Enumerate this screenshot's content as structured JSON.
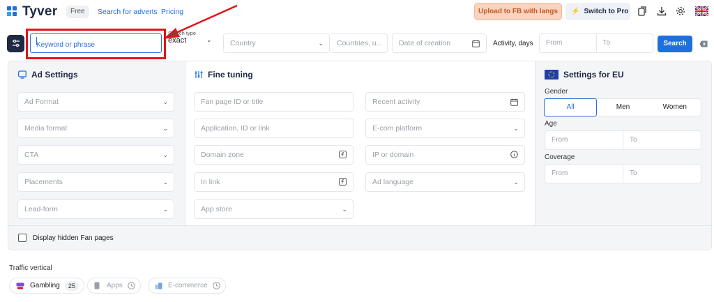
{
  "header": {
    "logo_text": "Tyver",
    "plan_badge": "Free",
    "nav": [
      "Search for adverts",
      "Pricing"
    ],
    "upload_button": "Upload to FB with langs",
    "pro_button": "Switch to Pro",
    "language": "EN (UK flag)"
  },
  "search": {
    "keyword_placeholder": "Keyword or phrase",
    "search_type_label": "Search type",
    "search_type_value": "exact",
    "country_placeholder": "Country",
    "countries_placeholder": "Countries, u...",
    "date_placeholder": "Date of creation",
    "activity_label": "Activity, days",
    "from_placeholder": "From",
    "to_placeholder": "To",
    "search_button": "Search"
  },
  "ad_settings": {
    "title": "Ad Settings",
    "fields": [
      "Ad Format",
      "Media format",
      "CTA",
      "Placements",
      "Lead-form"
    ]
  },
  "fine_tuning": {
    "title": "Fine tuning",
    "left_fields": [
      "Fan page ID or title",
      "Application, ID or link",
      "Domain zone",
      "In link",
      "App store"
    ],
    "right_fields": [
      "Recent activity",
      "E-com platform",
      "IP or domain",
      "Ad language"
    ]
  },
  "eu_settings": {
    "title": "Settings for EU",
    "gender_label": "Gender",
    "gender_options": [
      "All",
      "Men",
      "Women"
    ],
    "gender_selected": "All",
    "age_label": "Age",
    "coverage_label": "Coverage",
    "from_placeholder": "From",
    "to_placeholder": "To"
  },
  "hidden_fan_pages": {
    "label": "Display hidden Fan pages",
    "checked": false
  },
  "traffic_vertical": {
    "label": "Traffic vertical",
    "chips": [
      {
        "label": "Gambling",
        "count": "25",
        "icon": "gambling-icon"
      },
      {
        "label": "Apps",
        "icon": "phone-icon"
      },
      {
        "label": "E-commerce",
        "icon": "ecommerce-icon"
      }
    ]
  },
  "colors": {
    "accent": "#1f6fe0",
    "dark": "#1f2a44",
    "highlight": "#e0141a",
    "upload_bg": "#fbd3bf",
    "upload_text": "#c45a24"
  }
}
